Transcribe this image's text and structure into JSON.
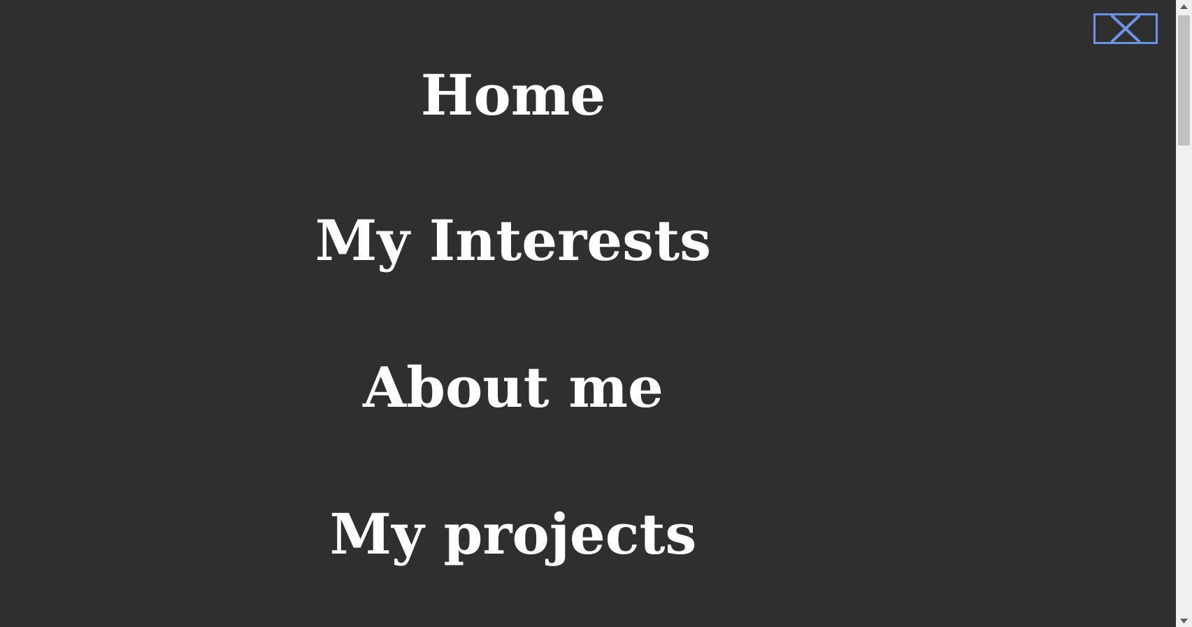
{
  "menu": {
    "items": [
      {
        "label": "Home"
      },
      {
        "label": "My Interests"
      },
      {
        "label": "About me"
      },
      {
        "label": "My projects"
      }
    ]
  },
  "close_button": {
    "icon": "close-icon",
    "border_color": "#6b94e6"
  },
  "colors": {
    "background": "#2f2f2f",
    "text": "#ffffff",
    "accent": "#6b94e6"
  }
}
